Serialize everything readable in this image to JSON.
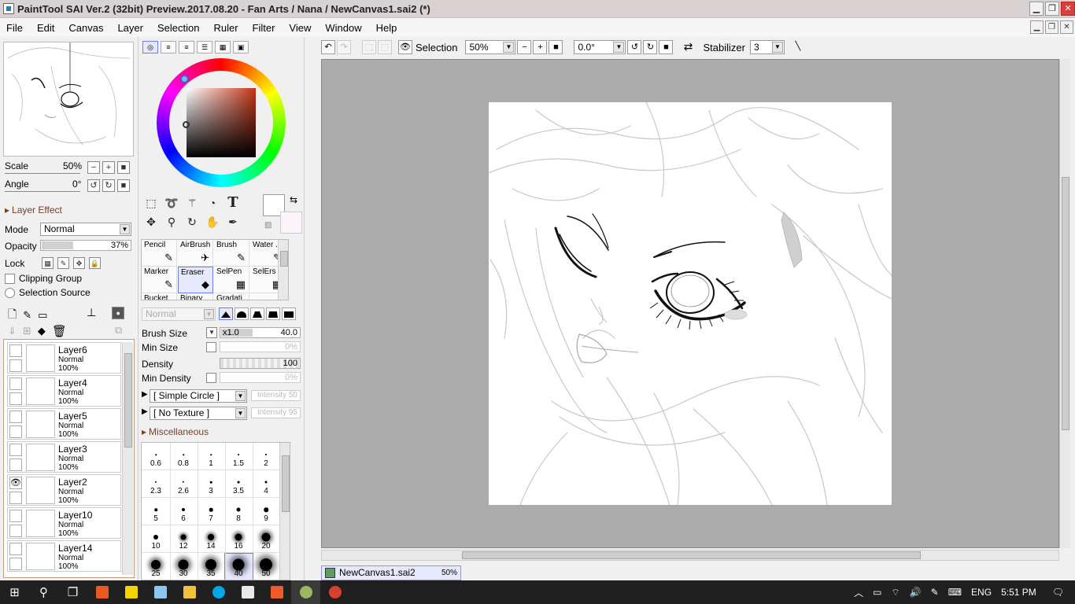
{
  "window": {
    "title": "PaintTool SAI Ver.2 (32bit) Preview.2017.08.20 - Fan Arts / Nana / NewCanvas1.sai2 (*)",
    "min": "▁",
    "restore": "❐",
    "close": "✕"
  },
  "menu": [
    "File",
    "Edit",
    "Canvas",
    "Layer",
    "Selection",
    "Ruler",
    "Filter",
    "View",
    "Window",
    "Help"
  ],
  "navigator": {
    "scale_label": "Scale",
    "scale_value": "50%",
    "angle_label": "Angle",
    "angle_value": "0°"
  },
  "layer_effect": {
    "header": "Layer Effect",
    "mode_label": "Mode",
    "mode_value": "Normal",
    "opacity_label": "Opacity",
    "opacity_value": "37%",
    "lock_label": "Lock",
    "clipping_label": "Clipping Group",
    "selection_source_label": "Selection Source"
  },
  "layers": [
    {
      "name": "Layer6",
      "mode": "Normal",
      "opacity": "100%",
      "visible": false
    },
    {
      "name": "Layer4",
      "mode": "Normal",
      "opacity": "100%",
      "visible": false
    },
    {
      "name": "Layer5",
      "mode": "Normal",
      "opacity": "100%",
      "visible": false
    },
    {
      "name": "Layer3",
      "mode": "Normal",
      "opacity": "100%",
      "visible": false
    },
    {
      "name": "Layer2",
      "mode": "Normal",
      "opacity": "100%",
      "visible": true
    },
    {
      "name": "Layer10",
      "mode": "Normal",
      "opacity": "100%",
      "visible": false
    },
    {
      "name": "Layer14",
      "mode": "Normal",
      "opacity": "100%",
      "visible": false
    }
  ],
  "tools": {
    "brushes": [
      {
        "name": "Pencil",
        "icon": "pencil-icon",
        "glyph": "✎"
      },
      {
        "name": "AirBrush",
        "icon": "airbrush-icon",
        "glyph": "✈"
      },
      {
        "name": "Brush",
        "icon": "brush-icon",
        "glyph": "✎"
      },
      {
        "name": "Water ...",
        "icon": "water-icon",
        "glyph": "✎"
      },
      {
        "name": "Marker",
        "icon": "marker-icon",
        "glyph": "✎"
      },
      {
        "name": "Eraser",
        "icon": "eraser-icon",
        "glyph": "◆"
      },
      {
        "name": "SelPen",
        "icon": "selpen-icon",
        "glyph": "▦"
      },
      {
        "name": "SelErs",
        "icon": "selers-icon",
        "glyph": "▦"
      },
      {
        "name": "Bucket",
        "icon": "bucket-icon",
        "glyph": ""
      },
      {
        "name": "Binary ...",
        "icon": "binary-icon",
        "glyph": ""
      },
      {
        "name": "Gradati...",
        "icon": "gradient-icon",
        "glyph": ""
      }
    ],
    "selected": "Eraser"
  },
  "brush_props": {
    "blend_value": "Normal",
    "brush_size_label": "Brush Size",
    "brush_size_mult": "x1.0",
    "brush_size_value": "40.0",
    "min_size_label": "Min Size",
    "min_size_value": "0%",
    "density_label": "Density",
    "density_value": "100",
    "min_density_label": "Min Density",
    "min_density_value": "0%",
    "shape_value": "[ Simple Circle ]",
    "shape_intensity": "Intensity 50",
    "texture_value": "[ No Texture ]",
    "texture_intensity": "Intensity 95",
    "misc_label": "Miscellaneous"
  },
  "brush_sizes": [
    [
      {
        "v": "0.6"
      },
      {
        "v": "0.8"
      },
      {
        "v": "1"
      },
      {
        "v": "1.5"
      },
      {
        "v": "2"
      }
    ],
    [
      {
        "v": "2.3"
      },
      {
        "v": "2.6"
      },
      {
        "v": "3"
      },
      {
        "v": "3.5"
      },
      {
        "v": "4"
      }
    ],
    [
      {
        "v": "5"
      },
      {
        "v": "6"
      },
      {
        "v": "7"
      },
      {
        "v": "8"
      },
      {
        "v": "9"
      }
    ],
    [
      {
        "v": "10"
      },
      {
        "v": "12"
      },
      {
        "v": "14"
      },
      {
        "v": "16"
      },
      {
        "v": "20"
      }
    ],
    [
      {
        "v": "25"
      },
      {
        "v": "30"
      },
      {
        "v": "35"
      },
      {
        "v": "40"
      },
      {
        "v": "50"
      }
    ]
  ],
  "brush_size_selected": "40",
  "canvas_toolbar": {
    "selection_label": "Selection",
    "zoom_value": "50%",
    "rotation_value": "0.0°",
    "stabilizer_label": "Stabilizer",
    "stabilizer_value": "3"
  },
  "document_tab": {
    "name": "NewCanvas1.sai2",
    "zoom": "50%"
  },
  "taskbar": {
    "language": "ENG",
    "time": "5:51 PM"
  }
}
